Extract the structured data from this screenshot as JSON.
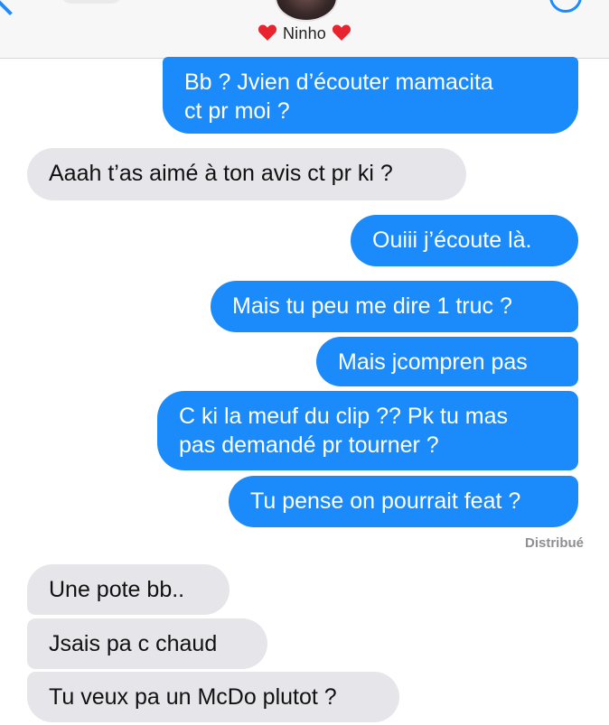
{
  "header": {
    "contact_name": "Ninho",
    "left_emoji": "heart-emoji",
    "right_emoji": "heart-emoji"
  },
  "colors": {
    "outgoing_bubble": "#1b8bfb",
    "incoming_bubble": "#e6e6ea",
    "accent": "#1a8cff"
  },
  "messages": [
    {
      "direction": "outgoing",
      "lines": [
        "Bb ? Jvien d’écouter mamacita",
        "ct pr moi ?"
      ]
    },
    {
      "direction": "incoming",
      "lines": [
        "Aaah t’as aimé à ton avis ct pr ki ?"
      ]
    },
    {
      "direction": "outgoing",
      "lines": [
        "Ouiii j’écoute là."
      ]
    },
    {
      "direction": "outgoing",
      "lines": [
        "Mais tu peu me dire 1 truc ?"
      ]
    },
    {
      "direction": "outgoing",
      "lines": [
        "Mais jcompren pas"
      ]
    },
    {
      "direction": "outgoing",
      "lines": [
        "C ki la meuf du clip ?? Pk tu mas",
        "pas demandé pr tourner ?"
      ]
    },
    {
      "direction": "outgoing",
      "lines": [
        "Tu pense on pourrait feat ?"
      ]
    },
    {
      "direction": "incoming",
      "lines": [
        "Une pote bb.."
      ]
    },
    {
      "direction": "incoming",
      "lines": [
        "Jsais pa c chaud"
      ]
    },
    {
      "direction": "incoming",
      "lines": [
        "Tu veux pa un McDo plutot ?"
      ]
    }
  ],
  "delivery_status": "Distribué"
}
